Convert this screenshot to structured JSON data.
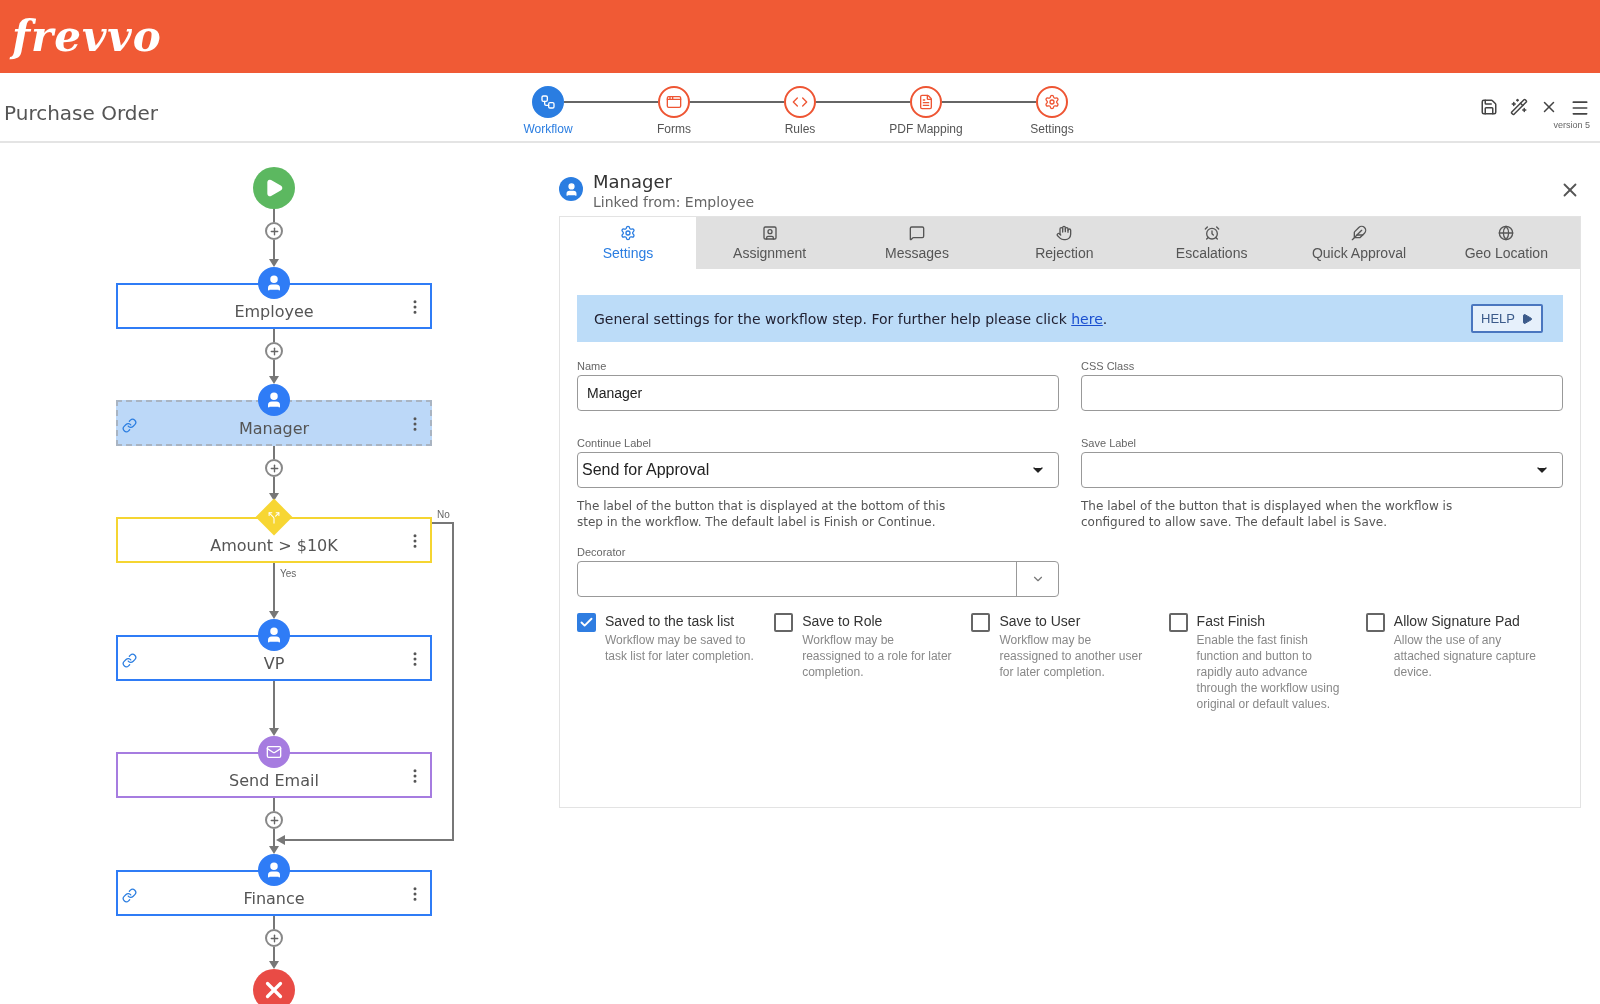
{
  "header": {
    "logo": "frevvo"
  },
  "toolbar": {
    "title": "Purchase Order",
    "steps": [
      {
        "label": "Workflow",
        "selected": true
      },
      {
        "label": "Forms",
        "selected": false
      },
      {
        "label": "Rules",
        "selected": false
      },
      {
        "label": "PDF Mapping",
        "selected": false
      },
      {
        "label": "Settings",
        "selected": false
      }
    ],
    "version": "version 5"
  },
  "workflow": {
    "nodes": [
      {
        "kind": "start"
      },
      {
        "kind": "add"
      },
      {
        "kind": "task",
        "label": "Employee",
        "linked": false,
        "selected": false
      },
      {
        "kind": "add"
      },
      {
        "kind": "task",
        "label": "Manager",
        "linked": true,
        "selected": true
      },
      {
        "kind": "add"
      },
      {
        "kind": "decision",
        "label": "Amount > $10K",
        "yes_label": "Yes",
        "no_label": "No",
        "linked": false,
        "selected": false
      },
      {
        "kind": "task",
        "label": "VP",
        "linked": true,
        "selected": false
      },
      {
        "kind": "email",
        "label": "Send Email",
        "linked": false,
        "selected": false
      },
      {
        "kind": "add"
      },
      {
        "kind": "task",
        "label": "Finance",
        "linked": true,
        "selected": false
      },
      {
        "kind": "add"
      },
      {
        "kind": "end"
      }
    ]
  },
  "panel": {
    "title": "Manager",
    "subtitle": "Linked from: Employee",
    "tabs": [
      {
        "label": "Settings",
        "selected": true
      },
      {
        "label": "Assignment",
        "selected": false
      },
      {
        "label": "Messages",
        "selected": false
      },
      {
        "label": "Rejection",
        "selected": false
      },
      {
        "label": "Escalations",
        "selected": false
      },
      {
        "label": "Quick Approval",
        "selected": false
      },
      {
        "label": "Geo Location",
        "selected": false
      }
    ],
    "banner": {
      "text": "General settings for the workflow step. For further help please click",
      "link": "here",
      "suffix": ".",
      "help_button": "HELP"
    },
    "fields": [
      {
        "kind": "text",
        "label": "Name",
        "value": "Manager"
      },
      {
        "kind": "text",
        "label": "CSS Class"
      },
      {
        "kind": "select",
        "label": "Continue Label",
        "value": "Send for Approval",
        "help": "The label of the button that is displayed at the bottom of this step in the workflow. The default label is Finish or Continue."
      },
      {
        "kind": "select",
        "label": "Save Label",
        "help": "The label of the button that is displayed when the workflow is configured to allow save. The default label is Save."
      },
      {
        "kind": "combo",
        "label": "Decorator"
      }
    ],
    "options": [
      {
        "label": "Saved to the task list",
        "description": "Workflow may be saved to task list for later completion.",
        "checked": true
      },
      {
        "label": "Save to Role",
        "description": "Workflow may be reassigned to a role for later completion.",
        "checked": false
      },
      {
        "label": "Save to User",
        "description": "Workflow may be reassigned to another user for later completion.",
        "checked": false
      },
      {
        "label": "Fast Finish",
        "description": "Enable the fast finish function and button to rapidly auto advance through the workflow using original or default values.",
        "checked": false
      },
      {
        "label": "Allow Signature Pad",
        "description": "Allow the use of any attached signature capture device.",
        "checked": false
      }
    ]
  }
}
